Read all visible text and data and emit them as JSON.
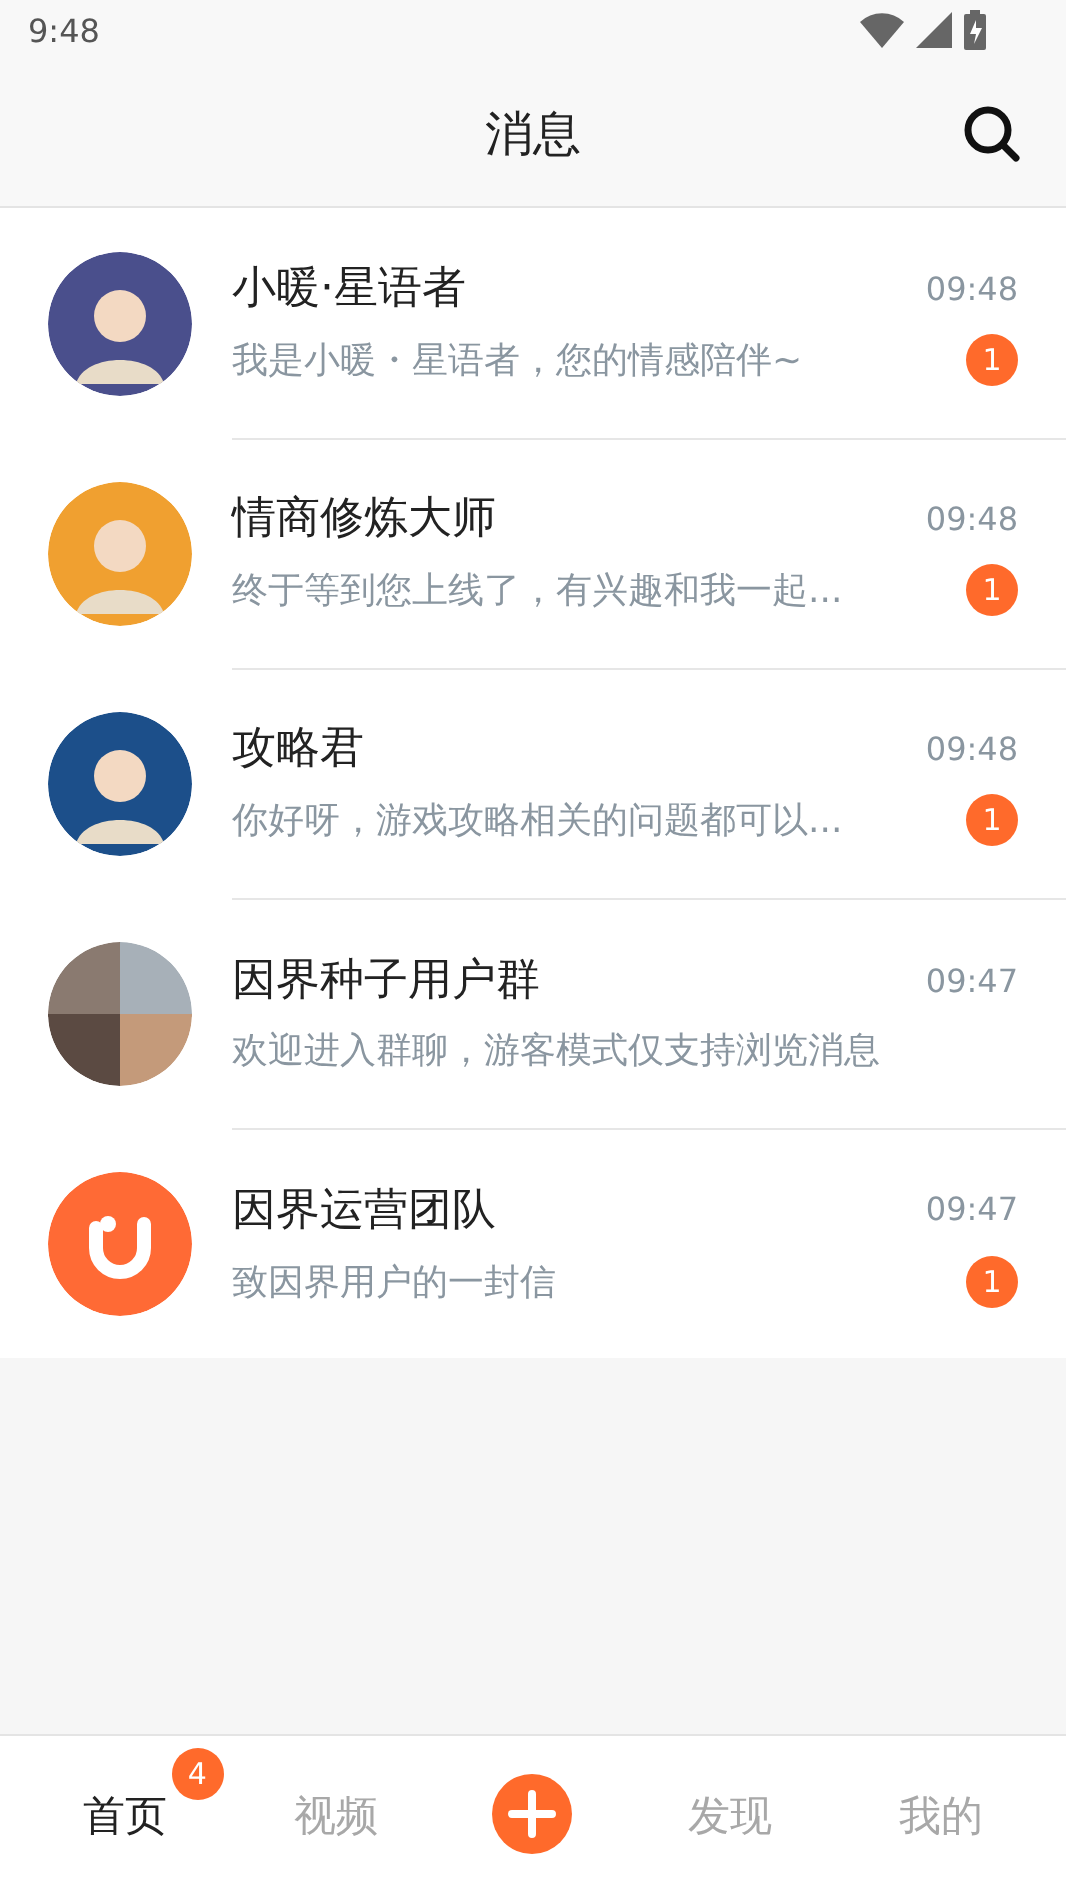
{
  "status_bar": {
    "time": "9:48"
  },
  "header": {
    "title": "消息"
  },
  "conversations": [
    {
      "name": "小暖·星语者",
      "time": "09:48",
      "preview": "我是小暖・星语者，您的情感陪伴~",
      "unread": "1",
      "avatar": {
        "kind": "picture",
        "color": "#4a4f8c"
      }
    },
    {
      "name": "情商修炼大师",
      "time": "09:48",
      "preview": "终于等到您上线了，有兴趣和我一起...",
      "unread": "1",
      "avatar": {
        "kind": "picture",
        "color": "#f0a030"
      }
    },
    {
      "name": "攻略君",
      "time": "09:48",
      "preview": "你好呀，游戏攻略相关的问题都可以...",
      "unread": "1",
      "avatar": {
        "kind": "picture",
        "color": "#1c4f8a"
      }
    },
    {
      "name": "因界种子用户群",
      "time": "09:47",
      "preview": "欢迎进入群聊，游客模式仅支持浏览消息",
      "avatar": {
        "kind": "group",
        "color": "#8a7a70"
      }
    },
    {
      "name": "因界运营团队",
      "time": "09:47",
      "preview": "致因界用户的一封信",
      "unread": "1",
      "avatar": {
        "kind": "logo",
        "color": "#ff6a35"
      }
    }
  ],
  "bottom_nav": [
    {
      "kind": "tab",
      "label": "首页",
      "selected": true,
      "badge": "4"
    },
    {
      "kind": "tab",
      "label": "视频",
      "selected": false
    },
    {
      "kind": "add"
    },
    {
      "kind": "tab",
      "label": "发现",
      "selected": false
    },
    {
      "kind": "tab",
      "label": "我的",
      "selected": false
    }
  ]
}
